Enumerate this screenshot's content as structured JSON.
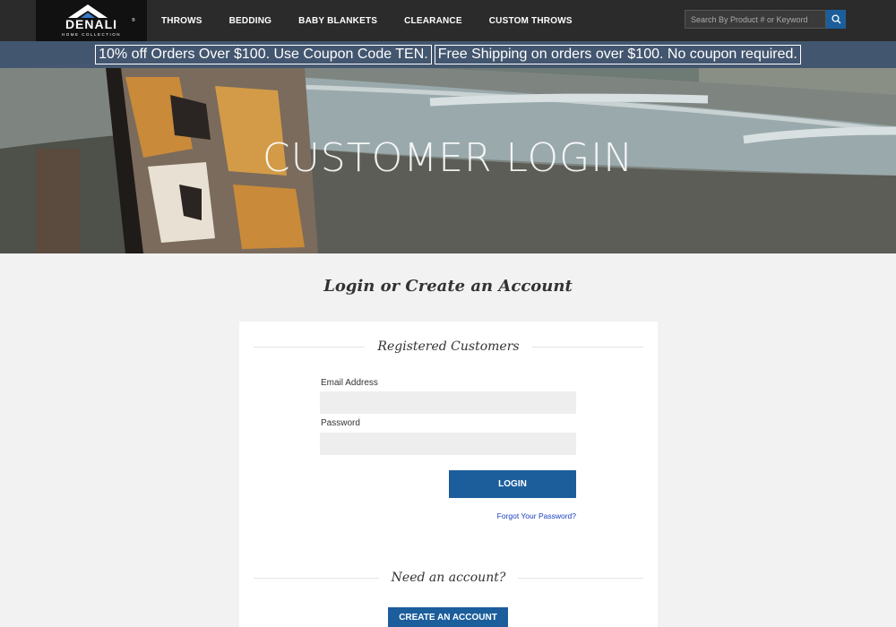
{
  "header": {
    "logo_text": "DENALI",
    "logo_subtext": "HOME COLLECTION",
    "nav": [
      "THROWS",
      "BEDDING",
      "BABY BLANKETS",
      "CLEARANCE",
      "CUSTOM THROWS"
    ],
    "search_placeholder": "Search By Product # or Keyword"
  },
  "promo": {
    "left": "10% off Orders Over $100. Use Coupon Code TEN.",
    "right": "Free Shipping on orders over $100. No coupon required."
  },
  "hero": {
    "title": "CUSTOMER LOGIN"
  },
  "main": {
    "heading": "Login or Create an Account",
    "registered_title": "Registered Customers",
    "email_label": "Email Address",
    "email_value": "",
    "password_label": "Password",
    "password_value": "",
    "login_button": "LOGIN",
    "forgot_link": "Forgot Your Password?",
    "need_account_title": "Need an account?",
    "create_button": "CREATE AN ACCOUNT"
  },
  "colors": {
    "header_bg": "#2b2b2b",
    "accent_blue": "#1c5e9c",
    "link_blue": "#1a3fbf",
    "page_bg": "#f2f2f2"
  }
}
